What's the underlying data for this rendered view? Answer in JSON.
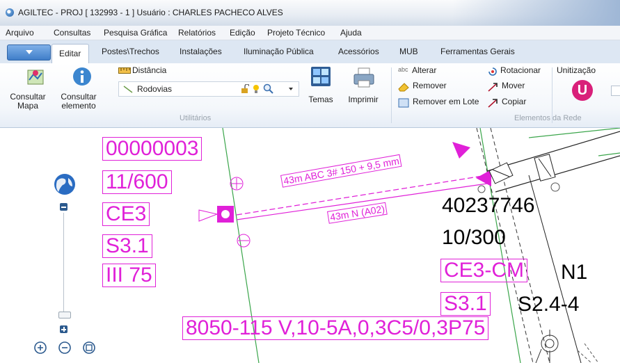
{
  "window": {
    "title": "AGILTEC - PROJ [ 132993 - 1 ] Usuário : CHARLES PACHECO ALVES"
  },
  "menu": [
    "Arquivo",
    "Consultas",
    "Pesquisa Gráfica",
    "Relatórios",
    "Edição",
    "Projeto Técnico",
    "Ajuda"
  ],
  "tabs": [
    "Editar",
    "Postes\\Trechos",
    "Instalações",
    "Iluminação Pública",
    "Acessórios",
    "MUB",
    "Ferramentas Gerais"
  ],
  "ribbon": {
    "consultar_mapa": [
      "Consultar",
      "Mapa"
    ],
    "consultar_elemento": [
      "Consultar",
      "elemento"
    ],
    "distancia": "Distância",
    "layer_select": "Rodovias",
    "temas": "Temas",
    "imprimir": "Imprimir",
    "utilitarios_label": "Utilitários",
    "alterar": "Alterar",
    "remover": "Remover",
    "remover_lote": "Remover em Lote",
    "rotacionar": "Rotacionar",
    "mover": "Mover",
    "copiar": "Copiar",
    "elementos_label": "Elementos da Rede",
    "unitizacao": "Unitização",
    "unitizacao_badge": "U"
  },
  "map": {
    "pink_boxes": [
      "00000003",
      "11/600",
      "CE3",
      "S3.1",
      "III 75",
      "CE3-CM",
      "S3.1",
      "8050-115 V,10-5A,0,3C5/0,3P75"
    ],
    "black_texts": [
      "40237746",
      "10/300",
      "N1",
      "S2.4-4"
    ],
    "span_labels": [
      "43m ABC 3# 150 + 9,5 mm",
      "43m N (A02)"
    ]
  },
  "colors": {
    "accent": "#e020d8",
    "ribbon_blue": "#3f7ec9",
    "unit_badge": "#d9207a"
  }
}
